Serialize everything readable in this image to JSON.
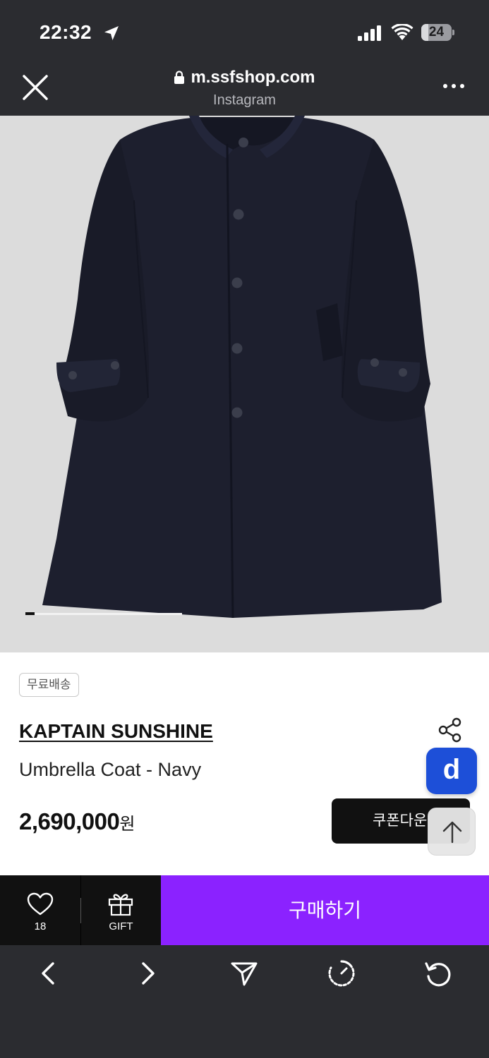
{
  "status_bar": {
    "time": "22:32",
    "battery_level": "24",
    "icons": [
      "location-arrow-icon",
      "cellular-signal-icon",
      "wifi-icon",
      "battery-icon"
    ]
  },
  "browser": {
    "url": "m.ssfshop.com",
    "source": "Instagram",
    "icons": [
      "close-icon",
      "lock-icon",
      "more-icon"
    ]
  },
  "gallery": {
    "current_slide": 1,
    "colors": {
      "background": "#dcdcdc",
      "coat": "#1d1f2e"
    }
  },
  "product": {
    "badge": "무료배송",
    "brand": "KAPTAIN SUNSHINE",
    "name": "Umbrella Coat - Navy",
    "price": "2,690,000",
    "currency": "원",
    "coupon_label": "쿠폰다운"
  },
  "floating": {
    "d_label": "d",
    "colors": {
      "d_button": "#1d4fd8"
    }
  },
  "action_bar": {
    "wish_count": "18",
    "gift_label": "GIFT",
    "buy_label": "구매하기",
    "colors": {
      "buy": "#8b22ff"
    }
  },
  "bottom_nav": {
    "icons": [
      "back-icon",
      "forward-icon",
      "share-send-icon",
      "timer-icon",
      "reload-icon"
    ]
  }
}
